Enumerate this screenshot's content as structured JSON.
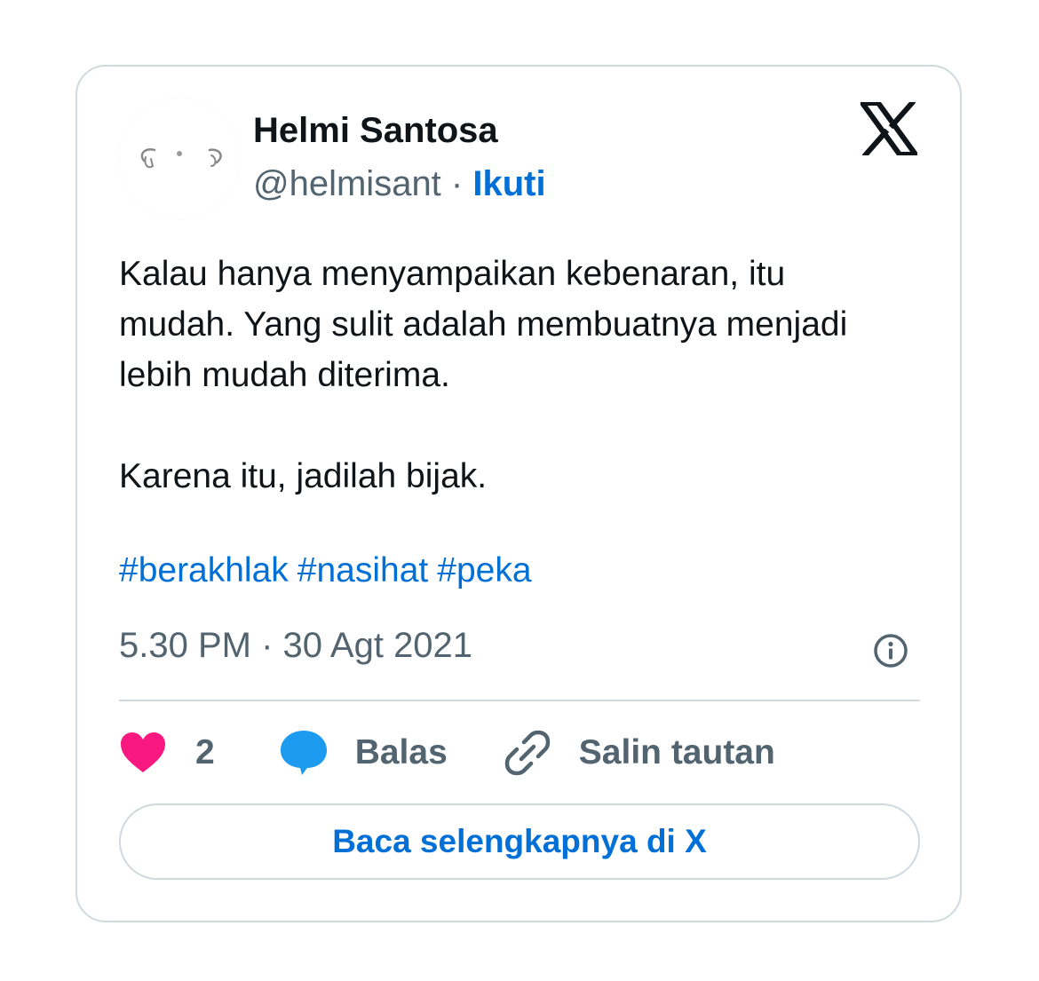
{
  "author": {
    "name": "Helmi Santosa",
    "handle": "@helmisant",
    "separator": "·",
    "follow_label": "Ikuti"
  },
  "tweet": {
    "paragraphs": [
      "Kalau hanya menyampaikan kebenaran, itu mudah. Yang sulit adalah membuatnya menjadi lebih mudah diterima.",
      "Karena itu, jadilah bijak."
    ],
    "hashtags": [
      "#berakhlak",
      "#nasihat",
      "#peka"
    ],
    "timestamp": "5.30 PM · 30 Agt 2021"
  },
  "actions": {
    "like_count": "2",
    "reply_label": "Balas",
    "copy_link_label": "Salin tautan"
  },
  "read_more_label": "Baca selengkapnya di X",
  "icons": {
    "brand": "x-logo-icon",
    "info": "info-icon",
    "like": "heart-icon",
    "reply": "speech-bubble-icon",
    "link": "link-icon"
  },
  "colors": {
    "link_blue": "#006fd6",
    "muted_text": "#536471",
    "heart": "#f91880",
    "reply_bubble": "#1d9bf0",
    "border": "#cfd9de"
  }
}
